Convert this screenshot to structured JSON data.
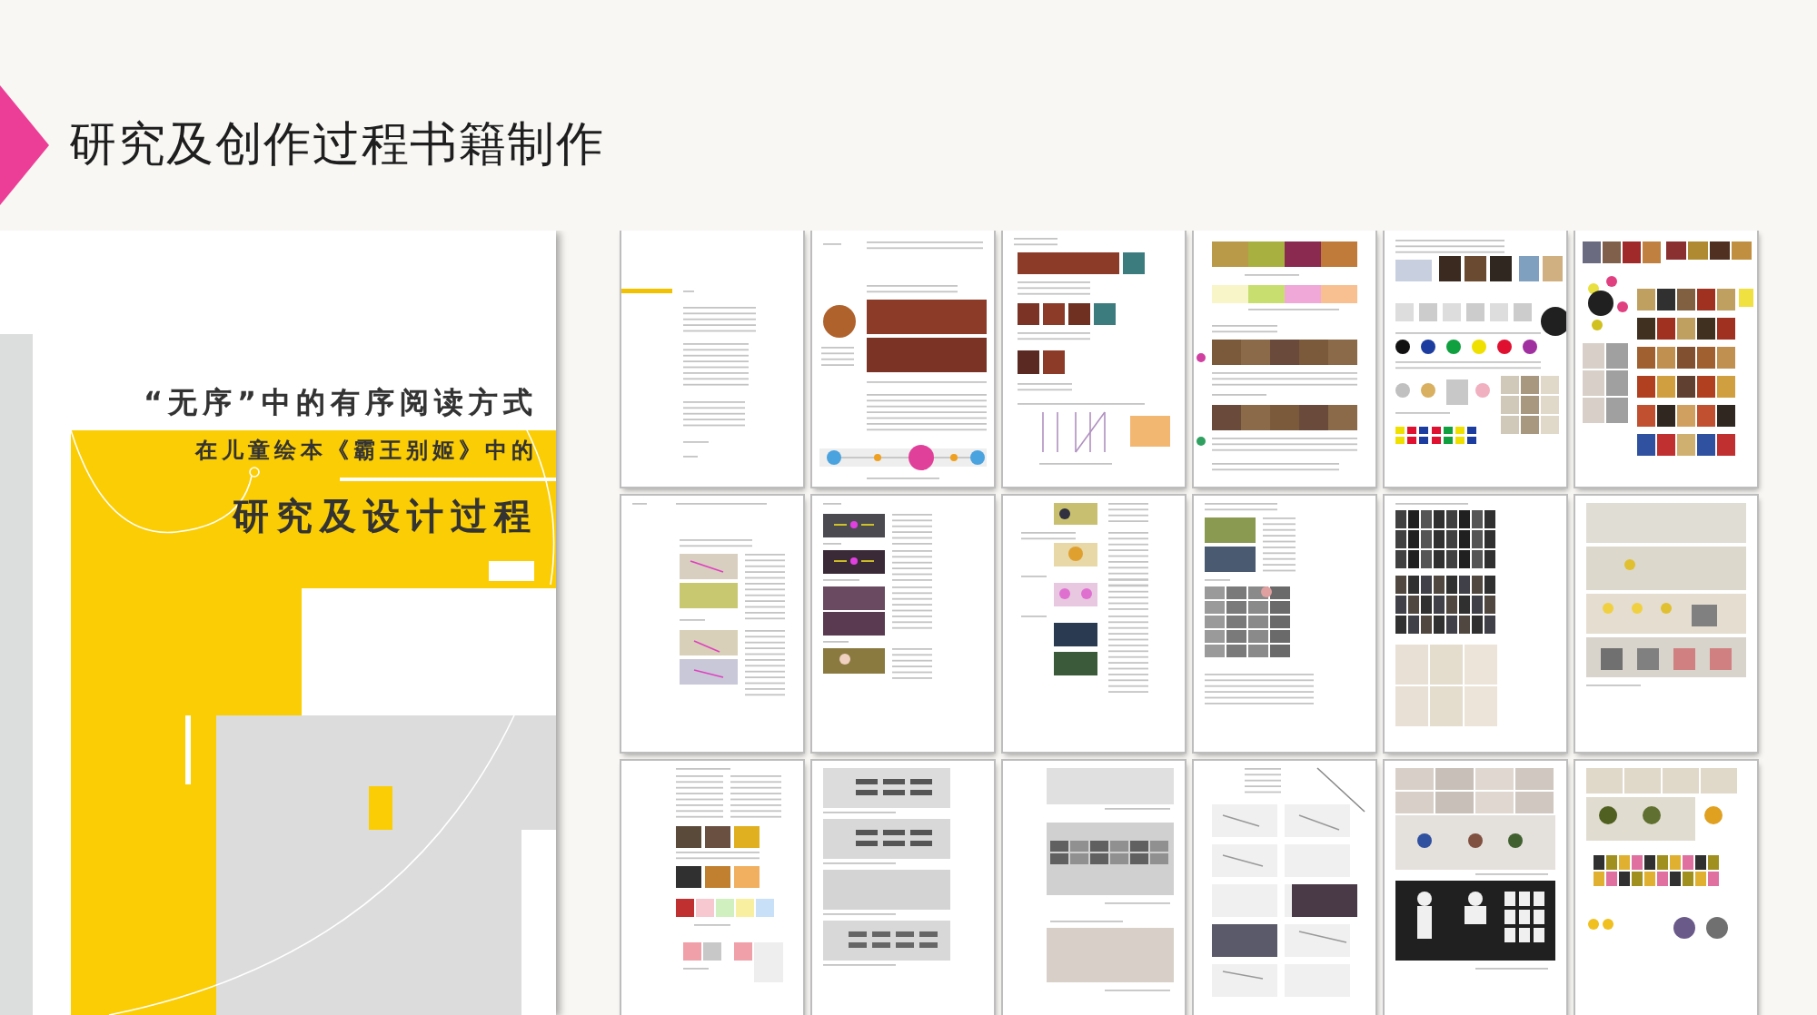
{
  "slide": {
    "title": "研究及创作过程书籍制作"
  },
  "cover": {
    "heading": "“无序”中的有序阅读方式",
    "subheading": "在儿童绘本《霸王别姬》中的",
    "title": "研究及设计过程"
  },
  "pages": [
    {
      "kind": "toc"
    },
    {
      "kind": "article"
    },
    {
      "kind": "mural"
    },
    {
      "kind": "color"
    },
    {
      "kind": "swatches"
    },
    {
      "kind": "collage"
    },
    {
      "kind": "annotated"
    },
    {
      "kind": "arrows"
    },
    {
      "kind": "characters"
    },
    {
      "kind": "scenes"
    },
    {
      "kind": "storyboard"
    },
    {
      "kind": "figures"
    },
    {
      "kind": "reference"
    },
    {
      "kind": "sketches"
    },
    {
      "kind": "drafts"
    },
    {
      "kind": "linework"
    },
    {
      "kind": "puppets"
    },
    {
      "kind": "parts"
    }
  ]
}
